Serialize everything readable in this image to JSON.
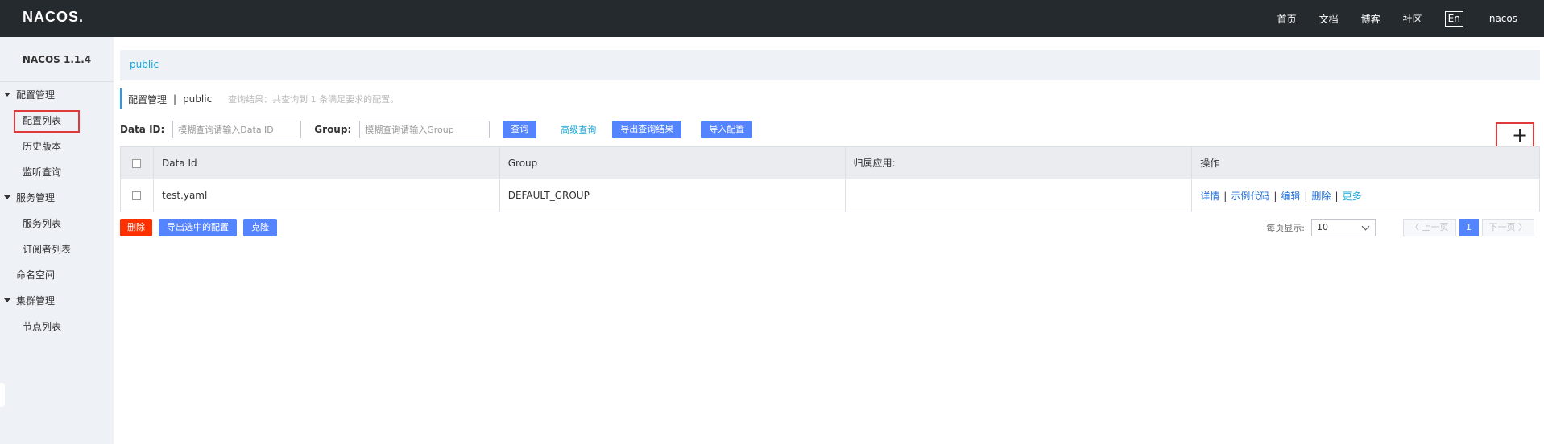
{
  "header": {
    "logo": "NACOS.",
    "nav": [
      "首页",
      "文档",
      "博客",
      "社区"
    ],
    "lang": "En",
    "user": "nacos"
  },
  "sidebar": {
    "version": "NACOS 1.1.4",
    "groups": [
      {
        "label": "配置管理",
        "items": [
          "配置列表",
          "历史版本",
          "监听查询"
        ]
      },
      {
        "label": "服务管理",
        "items": [
          "服务列表",
          "订阅者列表"
        ]
      },
      {
        "label": "命名空间"
      },
      {
        "label": "集群管理",
        "items": [
          "节点列表"
        ]
      }
    ]
  },
  "main": {
    "namespace": "public",
    "title": "配置管理",
    "title_ns": "public",
    "result_hint": "查询结果：共查询到 1 条满足要求的配置。",
    "search": {
      "dataid_label": "Data ID:",
      "dataid_placeholder": "模糊查询请输入Data ID",
      "group_label": "Group:",
      "group_placeholder": "模糊查询请输入Group",
      "query": "查询",
      "advanced": "高级查询",
      "export_results": "导出查询结果",
      "import": "导入配置"
    },
    "table": {
      "columns": [
        "Data Id",
        "Group",
        "归属应用:",
        "操作"
      ],
      "rows": [
        {
          "data_id": "test.yaml",
          "group": "DEFAULT_GROUP",
          "app": ""
        }
      ],
      "ops": [
        "详情",
        "示例代码",
        "编辑",
        "删除",
        "更多"
      ]
    },
    "actions": {
      "delete": "删除",
      "export_selected": "导出选中的配置",
      "clone": "克隆"
    },
    "pager": {
      "per_page_label": "每页显示:",
      "per_page": "10",
      "prev": "〈 上一页",
      "current": "1",
      "next": "下一页 〉"
    }
  }
}
